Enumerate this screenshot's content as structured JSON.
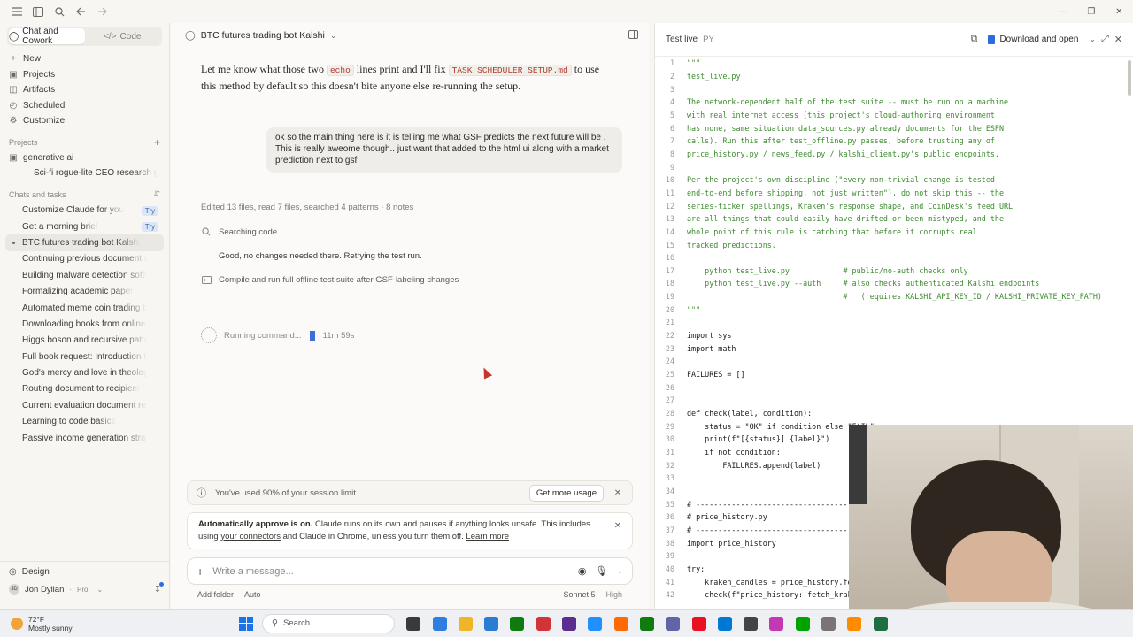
{
  "sidebar": {
    "mode_tabs": [
      {
        "label": "Chat and Cowork",
        "active": true
      },
      {
        "label": "Code",
        "active": false
      }
    ],
    "nav": [
      {
        "label": "New",
        "icon": "plus-icon"
      },
      {
        "label": "Projects",
        "icon": "folder-icon"
      },
      {
        "label": "Artifacts",
        "icon": "artifacts-icon"
      },
      {
        "label": "Scheduled",
        "icon": "clock-icon"
      },
      {
        "label": "Customize",
        "icon": "customize-icon"
      }
    ],
    "projects_header": "Projects",
    "projects": [
      {
        "label": "generative ai"
      },
      {
        "label": "Sci-fi rogue-lite CEO research gam"
      }
    ],
    "chats_header": "Chats and tasks",
    "chats": [
      {
        "label": "Customize Claude for you",
        "badge": "Try"
      },
      {
        "label": "Get a morning brief",
        "badge": "Try"
      },
      {
        "label": "BTC futures trading bot Kalshi",
        "active": true
      },
      {
        "label": "Continuing previous document discu"
      },
      {
        "label": "Building malware detection software"
      },
      {
        "label": "Formalizing academic paper"
      },
      {
        "label": "Automated meme coin trading bot"
      },
      {
        "label": "Downloading books from online sourc"
      },
      {
        "label": "Higgs boson and recursive patterns"
      },
      {
        "label": "Full book request: Introduction to pub"
      },
      {
        "label": "God's mercy and love in theological ev"
      },
      {
        "label": "Routing document to recipient"
      },
      {
        "label": "Current evaluation document review"
      },
      {
        "label": "Learning to code basics"
      },
      {
        "label": "Passive income generation strategies"
      }
    ],
    "design_label": "Design",
    "user": {
      "initials": "JD",
      "name": "Jon Dyllan",
      "plan": "Pro"
    }
  },
  "conversation": {
    "title": "BTC futures trading bot Kalshi",
    "assistant_text": {
      "pre": "Let me know what those two ",
      "code1": "echo",
      "mid": " lines print and I'll fix ",
      "code2": "TASK_SCHEDULER_SETUP.md",
      "post": " to use this method by default so this doesn't bite anyone else re-running the setup."
    },
    "user_message": "ok so the main thing here is it is telling me what GSF predicts the next future will be . This is really aweome though.. just want that added to the html ui along with a market prediction next to gsf",
    "edited_summary": "Edited 13 files, read 7 files, searched 4 patterns · 8 notes",
    "steps": [
      {
        "label": "Searching code",
        "icon": "search-icon"
      },
      {
        "label": "Good, no changes needed there. Retrying the test run.",
        "icon": "none"
      },
      {
        "label": "Compile and run full offline test suite after GSF-labeling changes",
        "icon": "terminal-icon"
      }
    ],
    "running_label": "Running command...",
    "running_time": "11m 59s"
  },
  "usage_banner": {
    "text": "You've used 90% of your session limit",
    "button": "Get more usage"
  },
  "approve_banner": {
    "bold": "Automatically approve is on.",
    "text1": " Claude runs on its own and pauses if anything looks unsafe. This includes using ",
    "link1": "your connectors",
    "text2": " and Claude in Chrome, unless you turn them off. ",
    "link2": "Learn more"
  },
  "composer": {
    "placeholder": "Write a message...",
    "add_folder": "Add folder",
    "mode": "Auto",
    "model": "Sonnet 5",
    "effort": "High"
  },
  "code_panel": {
    "title": "Test live",
    "lang": "PY",
    "download_label": "Download and open",
    "lines": [
      {
        "t": "\"\"\"",
        "c": "doc"
      },
      {
        "t": "test_live.py",
        "c": "doc"
      },
      {
        "t": "",
        "c": "doc"
      },
      {
        "t": "The network-dependent half of the test suite -- must be run on a machine",
        "c": "doc"
      },
      {
        "t": "with real internet access (this project's cloud-authoring environment",
        "c": "doc"
      },
      {
        "t": "has none, same situation data_sources.py already documents for the ESPN",
        "c": "doc"
      },
      {
        "t": "calls). Run this after test_offline.py passes, before trusting any of",
        "c": "doc"
      },
      {
        "t": "price_history.py / news_feed.py / kalshi_client.py's public endpoints.",
        "c": "doc"
      },
      {
        "t": "",
        "c": "doc"
      },
      {
        "t": "Per the project's own discipline (\"every non-trivial change is tested",
        "c": "doc"
      },
      {
        "t": "end-to-end before shipping, not just written\"), do not skip this -- the",
        "c": "doc"
      },
      {
        "t": "series-ticker spellings, Kraken's response shape, and CoinDesk's feed URL",
        "c": "doc"
      },
      {
        "t": "are all things that could easily have drifted or been mistyped, and the",
        "c": "doc"
      },
      {
        "t": "whole point of this rule is catching that before it corrupts real",
        "c": "doc"
      },
      {
        "t": "tracked predictions.",
        "c": "doc"
      },
      {
        "t": "",
        "c": "doc"
      },
      {
        "t": "    python test_live.py            # public/no-auth checks only",
        "c": "doc"
      },
      {
        "t": "    python test_live.py --auth     # also checks authenticated Kalshi endpoints",
        "c": "doc"
      },
      {
        "t": "                                   #   (requires KALSHI_API_KEY_ID / KALSHI_PRIVATE_KEY_PATH)",
        "c": "doc"
      },
      {
        "t": "\"\"\"",
        "c": "doc"
      },
      {
        "t": "",
        "c": "kw"
      },
      {
        "t": "import sys",
        "c": "kw"
      },
      {
        "t": "import math",
        "c": "kw"
      },
      {
        "t": "",
        "c": "kw"
      },
      {
        "t": "FAILURES = []",
        "c": "kw"
      },
      {
        "t": "",
        "c": "kw"
      },
      {
        "t": "",
        "c": "kw"
      },
      {
        "t": "def check(label, condition):",
        "c": "kw"
      },
      {
        "t": "    status = \"OK\" if condition else \"FAIL\"",
        "c": "kw"
      },
      {
        "t": "    print(f\"[{status}] {label}\")",
        "c": "kw"
      },
      {
        "t": "    if not condition:",
        "c": "kw"
      },
      {
        "t": "        FAILURES.append(label)",
        "c": "kw"
      },
      {
        "t": "",
        "c": "kw"
      },
      {
        "t": "",
        "c": "kw"
      },
      {
        "t": "# ------------------------------------------------------------------",
        "c": "kw"
      },
      {
        "t": "# price_history.py",
        "c": "kw"
      },
      {
        "t": "# ------------------------------------------------------------------",
        "c": "kw"
      },
      {
        "t": "import price_history",
        "c": "kw"
      },
      {
        "t": "",
        "c": "kw"
      },
      {
        "t": "try:",
        "c": "kw"
      },
      {
        "t": "    kraken_candles = price_history.fetch_kraken",
        "c": "kw"
      },
      {
        "t": "    check(f\"price_history: fetch_kraken",
        "c": "kw"
      }
    ]
  },
  "taskbar": {
    "temp": "72°F",
    "condition": "Mostly sunny",
    "search_label": "Search",
    "app_colors": [
      "#3a3a3a",
      "#2e7de1",
      "#f0b429",
      "#2b7cd3",
      "#0f7b0f",
      "#d13438",
      "#5c2d91",
      "#1e90ff",
      "#ff6a00",
      "#107c10",
      "#6264a7",
      "#e81123",
      "#0078d4",
      "#444444",
      "#c239b3",
      "#00a300",
      "#7a7574",
      "#ff8c00",
      "#1d6f42"
    ]
  }
}
